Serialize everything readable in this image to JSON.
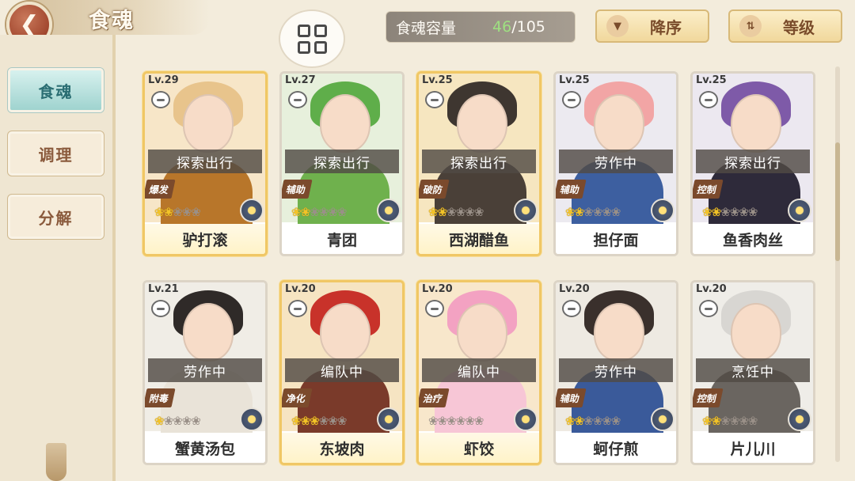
{
  "header": {
    "title": "食魂",
    "back_icon": "chevron-left-icon",
    "grid_icon": "grid-view-icon",
    "capacity_label": "食魂容量",
    "capacity_current": "46",
    "capacity_max": "/105",
    "sort_order_label": "降序",
    "sort_order_icon": "triangle-down-icon",
    "sort_key_label": "等级",
    "sort_key_icon": "sort-arrows-icon"
  },
  "sidebar": {
    "items": [
      {
        "label": "食魂",
        "active": true
      },
      {
        "label": "调理",
        "active": false
      },
      {
        "label": "分解",
        "active": false
      }
    ]
  },
  "cards": [
    {
      "level": "Lv.29",
      "status": "探索出行",
      "role": "爆发",
      "name": "驴打滚",
      "stars": 2,
      "max_stars": 5,
      "rarity": "gold",
      "hair": "#e8c48c",
      "body": "#b8762a",
      "bg": "#f7e6c8"
    },
    {
      "level": "Lv.27",
      "status": "探索出行",
      "role": "辅助",
      "name": "青团",
      "stars": 2,
      "max_stars": 6,
      "rarity": "normal",
      "hair": "#5fae4a",
      "body": "#6fb14d",
      "bg": "#e7f0dc"
    },
    {
      "level": "Lv.25",
      "status": "探索出行",
      "role": "破防",
      "name": "西湖醋鱼",
      "stars": 2,
      "max_stars": 6,
      "rarity": "gold",
      "hair": "#3e3630",
      "body": "#4a4038",
      "bg": "#f6e6c0"
    },
    {
      "level": "Lv.25",
      "status": "劳作中",
      "role": "辅助",
      "name": "担仔面",
      "stars": 2,
      "max_stars": 6,
      "rarity": "normal",
      "hair": "#f2a5a5",
      "body": "#3d5fa0",
      "bg": "#eceaf0"
    },
    {
      "level": "Lv.25",
      "status": "探索出行",
      "role": "控制",
      "name": "鱼香肉丝",
      "stars": 2,
      "max_stars": 6,
      "rarity": "normal",
      "hair": "#7e5aa8",
      "body": "#2e2a3a",
      "bg": "#ece8f0"
    },
    {
      "level": "Lv.21",
      "status": "劳作中",
      "role": "附毒",
      "name": "蟹黄汤包",
      "stars": 1,
      "max_stars": 5,
      "rarity": "normal",
      "hair": "#2f2a28",
      "body": "#e9e3d8",
      "bg": "#f0ede6"
    },
    {
      "level": "Lv.20",
      "status": "编队中",
      "role": "净化",
      "name": "东坡肉",
      "stars": 3,
      "max_stars": 6,
      "rarity": "gold",
      "hair": "#c8322a",
      "body": "#7a3a2a",
      "bg": "#f6e4c2"
    },
    {
      "level": "Lv.20",
      "status": "编队中",
      "role": "治疗",
      "name": "虾饺",
      "stars": 0,
      "max_stars": 6,
      "rarity": "gold",
      "hair": "#f3a2c2",
      "body": "#f7c6d6",
      "bg": "#f8e7cb"
    },
    {
      "level": "Lv.20",
      "status": "劳作中",
      "role": "辅助",
      "name": "蚵仔煎",
      "stars": 2,
      "max_stars": 6,
      "rarity": "normal",
      "hair": "#3a302c",
      "body": "#3a5a9a",
      "bg": "#eeeae2"
    },
    {
      "level": "Lv.20",
      "status": "烹饪中",
      "role": "控制",
      "name": "片儿川",
      "stars": 2,
      "max_stars": 6,
      "rarity": "normal",
      "hair": "#d8d6d2",
      "body": "#6a6560",
      "bg": "#efede8"
    }
  ],
  "colors": {
    "accent_teal": "#9fd3cf",
    "capacity_current_green": "#9ee081",
    "star_gold": "#f2c328",
    "role_badge": "#7b4a2c"
  }
}
